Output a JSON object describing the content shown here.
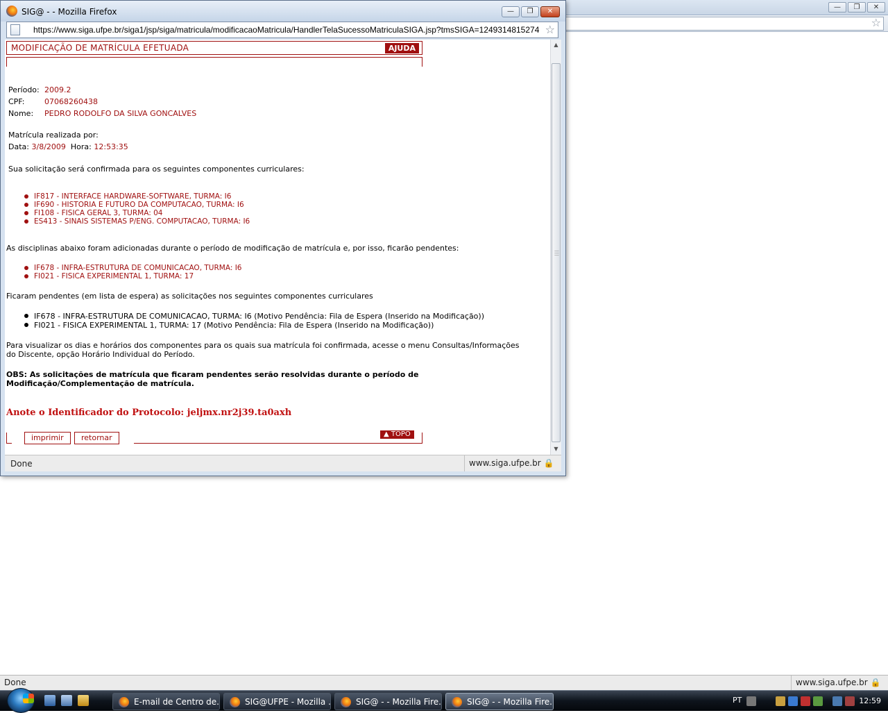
{
  "browser_bg": {
    "status_text": "Done",
    "status_domain": "www.siga.ufpe.br"
  },
  "popup": {
    "title": "SIG@ - - Mozilla Firefox",
    "url": "https://www.siga.ufpe.br/siga1/jsp/siga/matricula/modificacaoMatricula/HandlerTelaSucessoMatriculaSIGA.jsp?tmsSIGA=1249314815274",
    "status_text": "Done",
    "status_domain": "www.siga.ufpe.br"
  },
  "page": {
    "header_title": "MODIFICAÇÃO DE MATRÍCULA EFETUADA",
    "help_label": "AJUDA",
    "periodo_label": "Período:",
    "periodo_value": "2009.2",
    "cpf_label": "CPF:",
    "cpf_value": "07068260438",
    "nome_label": "Nome:",
    "nome_value": "PEDRO RODOLFO DA SILVA GONCALVES",
    "realizada_por": "Matrícula realizada por:",
    "data_label": "Data:",
    "data_value": "3/8/2009",
    "hora_label": "Hora:",
    "hora_value": "12:53:35",
    "confirmada_text": "Sua solicitação será confirmada para os seguintes componentes curriculares:",
    "confirmed_courses": [
      "IF817 - INTERFACE HARDWARE-SOFTWARE, TURMA: I6",
      "IF690 - HISTORIA E FUTURO DA COMPUTACAO, TURMA: I6",
      "FI108 - FISICA GERAL 3, TURMA: 04",
      "ES413 - SINAIS SISTEMAS P/ENG. COMPUTACAO, TURMA: I6"
    ],
    "added_text": "As disciplinas abaixo foram adicionadas durante o período de modificação de matrícula e, por isso, ficarão pendentes:",
    "added_courses": [
      "IF678 - INFRA-ESTRUTURA DE COMUNICACAO, TURMA: I6",
      "FI021 - FISICA EXPERIMENTAL 1, TURMA: 17"
    ],
    "pending_text": "Ficaram pendentes (em lista de espera) as solicitações nos seguintes componentes curriculares",
    "pending_courses": [
      "IF678 - INFRA-ESTRUTURA DE COMUNICACAO, TURMA: I6 (Motivo Pendência: Fila de Espera (Inserido na Modificação))",
      "FI021 - FISICA EXPERIMENTAL 1, TURMA: 17 (Motivo Pendência: Fila de Espera (Inserido na Modificação))"
    ],
    "visualizar_line1": " Para visualizar os dias e horários dos componentes para os quais sua matrícula foi confirmada, acesse o menu Consultas/Informações",
    "visualizar_line2": "do Discente, opção Horário Individual do Período.",
    "obs_text": "OBS: As solicitações de matrícula que ficaram pendentes serão resolvidas durante o período de Modificação/Complementação de matrícula.",
    "protocol_text": "Anote o Identificador do Protocolo: jeljmx.nr2j39.ta0axh",
    "print_label": "imprimir",
    "back_label": "retornar",
    "top_label": "TOPO"
  },
  "taskbar": {
    "tasks": [
      "E-mail de Centro de...",
      "SIG@UFPE - Mozilla ...",
      "SIG@ - - Mozilla Fire...",
      "SIG@ - - Mozilla Fire..."
    ],
    "language": "PT",
    "clock": "12:59"
  }
}
